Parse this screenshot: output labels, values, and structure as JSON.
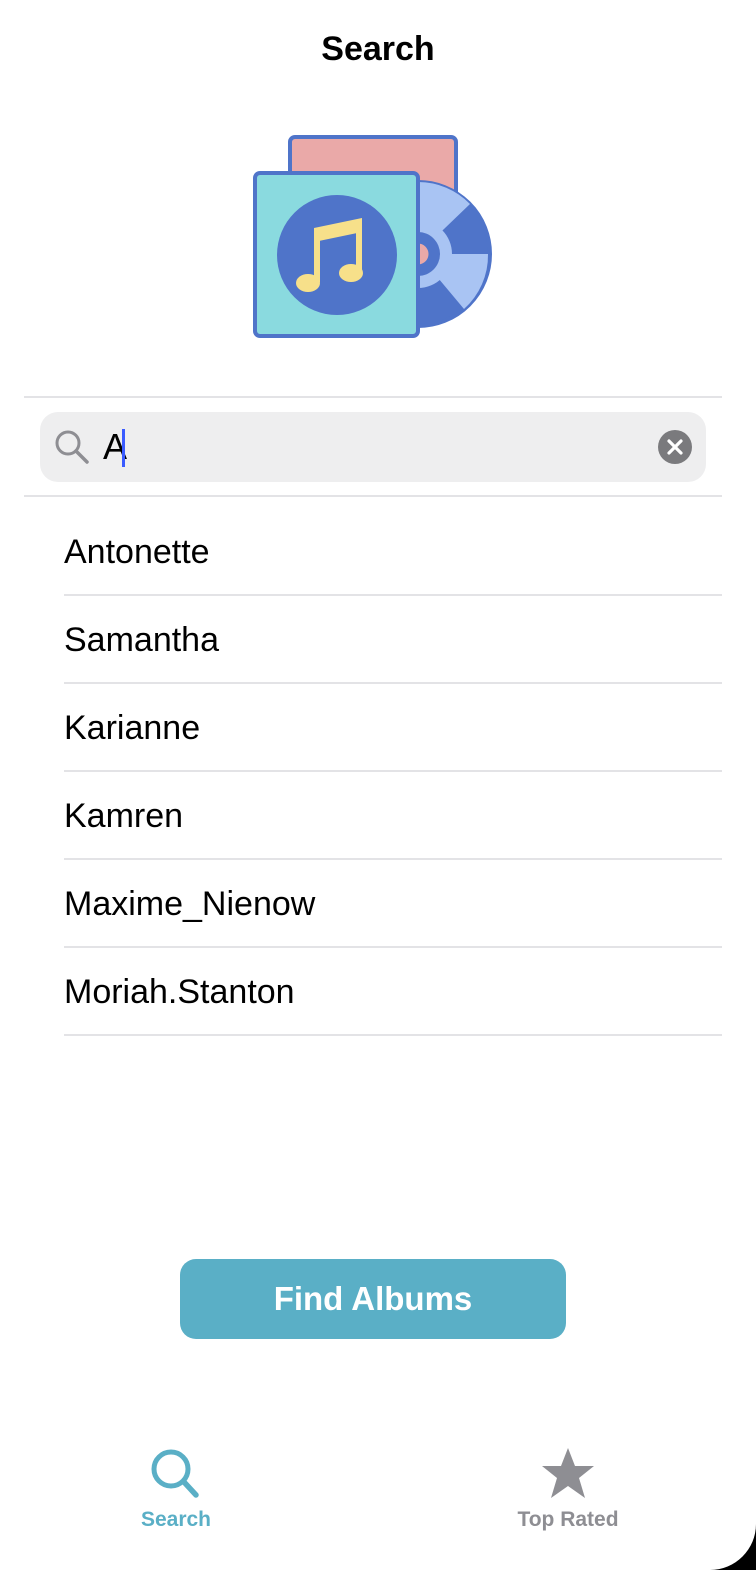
{
  "nav": {
    "title": "Search"
  },
  "search": {
    "value": "A"
  },
  "results": [
    {
      "label": "Antonette"
    },
    {
      "label": "Samantha"
    },
    {
      "label": "Karianne"
    },
    {
      "label": "Kamren"
    },
    {
      "label": "Maxime_Nienow"
    },
    {
      "label": "Moriah.Stanton"
    }
  ],
  "actions": {
    "find_albums": "Find Albums"
  },
  "tabbar": {
    "search": {
      "label": "Search",
      "icon": "magnifier-icon",
      "active": true
    },
    "top_rated": {
      "label": "Top Rated",
      "icon": "star-icon",
      "active": false
    }
  },
  "colors": {
    "accent": "#5aafc6",
    "inactive": "#8e8e93",
    "album_front": "#8adadf",
    "album_back": "#eaa9a8",
    "disc": "#4f74c9",
    "note": "#f7e08a"
  }
}
